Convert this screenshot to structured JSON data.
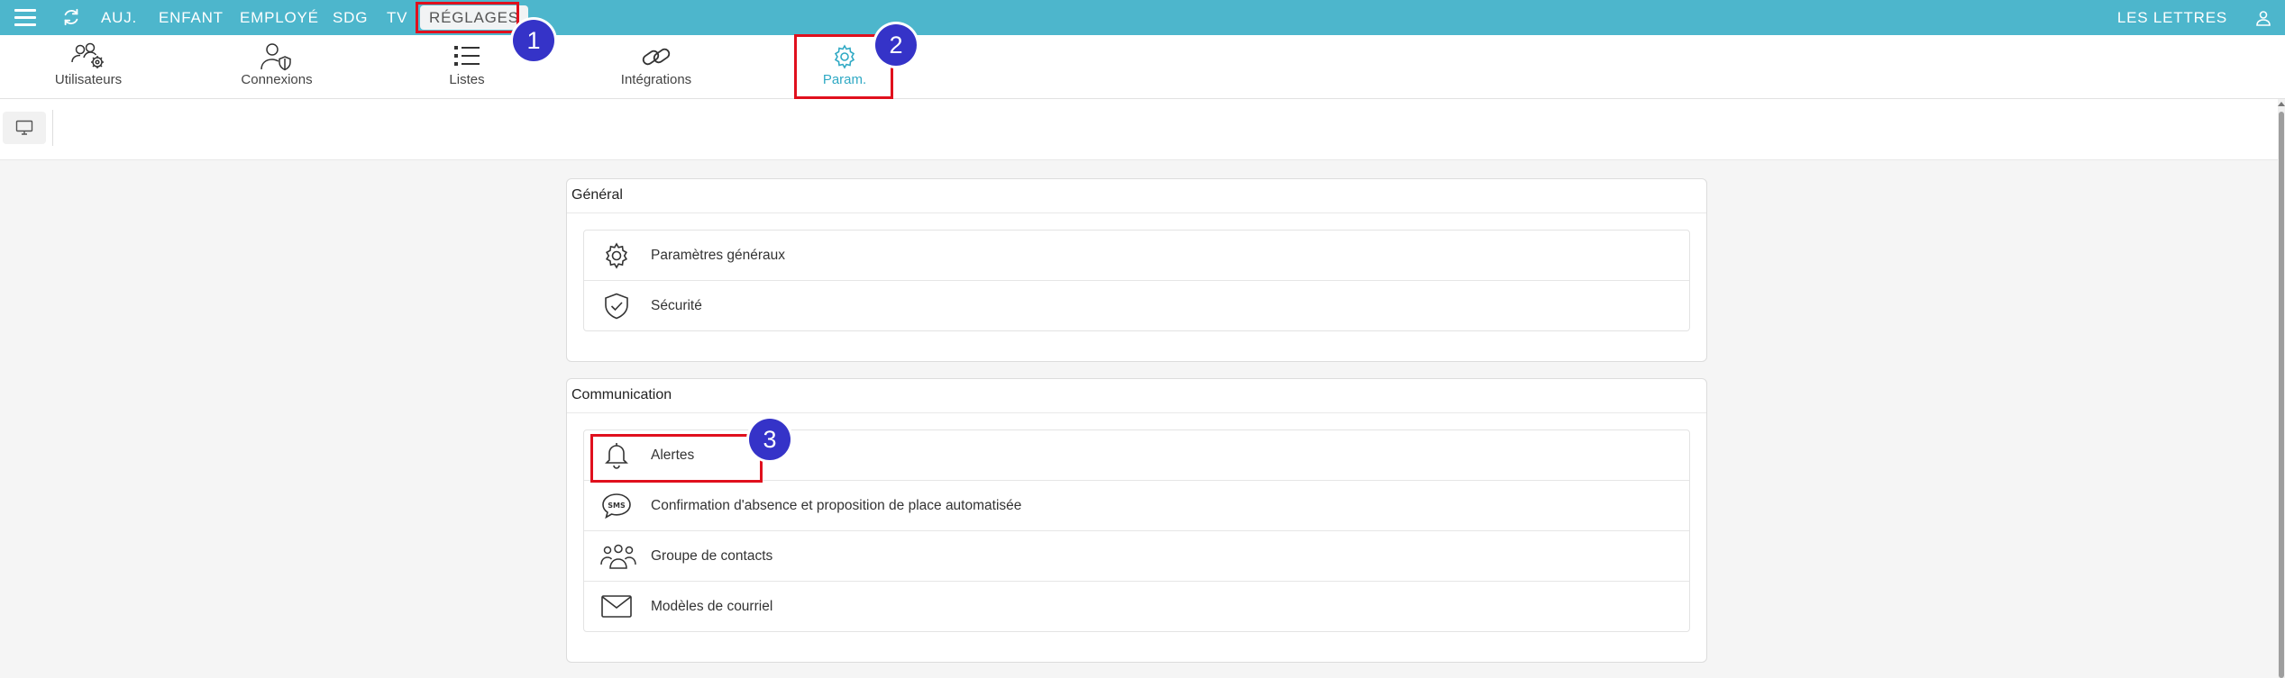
{
  "topbar": {
    "nav": [
      {
        "label": "AUJ."
      },
      {
        "label": "ENFANT"
      },
      {
        "label": "EMPLOYÉ"
      },
      {
        "label": "SDG"
      },
      {
        "label": "TV"
      },
      {
        "label": "RÉGLAGES",
        "active": true
      }
    ],
    "organization": "LES LETTRES"
  },
  "tabs": [
    {
      "label": "Utilisateurs",
      "icon": "users-gear-icon"
    },
    {
      "label": "Connexions",
      "icon": "user-shield-icon"
    },
    {
      "label": "Listes",
      "icon": "list-icon"
    },
    {
      "label": "Intégrations",
      "icon": "link-icon"
    },
    {
      "label": "Param.",
      "icon": "gear-icon",
      "active": true
    }
  ],
  "toolbar": {
    "view_button_icon": "monitor-icon"
  },
  "sections": [
    {
      "title": "Général",
      "items": [
        {
          "label": "Paramètres généraux",
          "icon": "gear-icon"
        },
        {
          "label": "Sécurité",
          "icon": "shield-check-icon"
        }
      ]
    },
    {
      "title": "Communication",
      "items": [
        {
          "label": "Alertes",
          "icon": "bell-icon"
        },
        {
          "label": "Confirmation d'absence et proposition de place automatisée",
          "icon": "sms-icon"
        },
        {
          "label": "Groupe de contacts",
          "icon": "people-group-icon"
        },
        {
          "label": "Modèles de courriel",
          "icon": "envelope-icon"
        }
      ]
    }
  ],
  "annotations": [
    {
      "number": "1"
    },
    {
      "number": "2"
    },
    {
      "number": "3"
    }
  ],
  "colors": {
    "topbar": "#4db6cc",
    "accent": "#2fa9c4",
    "highlight": "#e0101d",
    "badge": "#3533c8"
  }
}
